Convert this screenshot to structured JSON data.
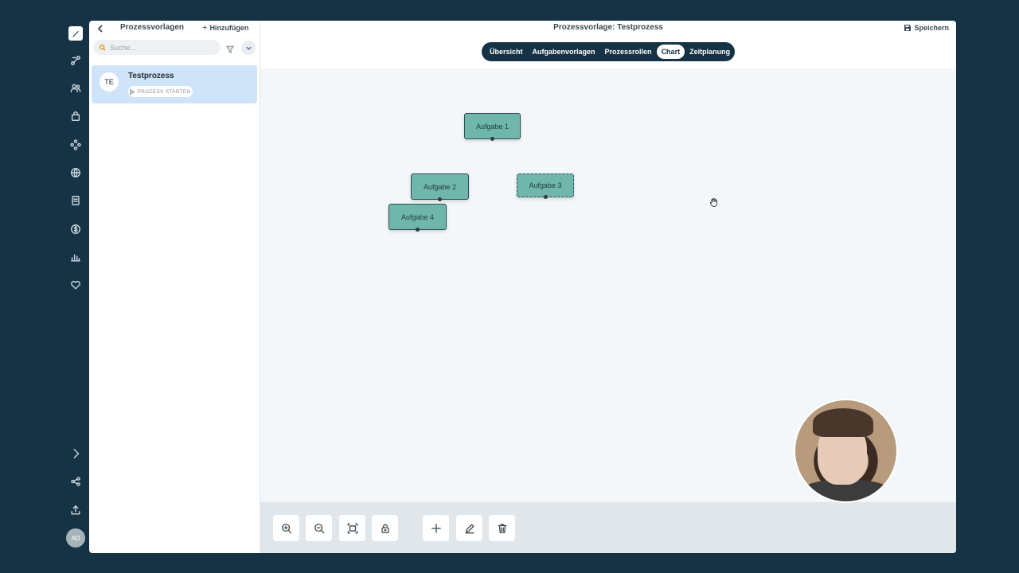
{
  "sidebar": {
    "icons": [
      "edit-icon",
      "process-icon",
      "users-icon",
      "bag-icon",
      "network-icon",
      "globe-icon",
      "book-icon",
      "dollar-icon",
      "bar-chart-icon",
      "heart-icon",
      "expand-icon",
      "share-icon",
      "upload-icon"
    ],
    "avatar_initials": "AD"
  },
  "list_panel": {
    "title": "Prozessvorlagen",
    "add_label": "Hinzufügen",
    "search_placeholder": "Suche...",
    "items": [
      {
        "initials": "TE",
        "name": "Testprozess",
        "action_label": "PROZESS STARTEN"
      }
    ]
  },
  "header": {
    "title": "Prozessvorlage: Testprozess",
    "save_label": "Speichern"
  },
  "tabs": [
    {
      "label": "Übersicht",
      "active": false
    },
    {
      "label": "Aufgabenvorlagen",
      "active": false
    },
    {
      "label": "Prozessrollen",
      "active": false
    },
    {
      "label": "Chart",
      "active": true
    },
    {
      "label": "Zeitplanung",
      "active": false
    }
  ],
  "canvas": {
    "nodes": [
      {
        "label": "Aufgabe 1"
      },
      {
        "label": "Aufgabe 2"
      },
      {
        "label": "Aufgabe 3",
        "selected": true
      },
      {
        "label": "Aufgabe 4"
      }
    ]
  },
  "toolbar": {
    "buttons": [
      "zoom-in-icon",
      "zoom-out-icon",
      "fit-view-icon",
      "lock-icon",
      "add-icon",
      "edit-icon",
      "delete-icon"
    ]
  },
  "colors": {
    "rail": "#163345",
    "node_fill": "#6fb7aa",
    "selected_item": "#cfe4f8",
    "accent": "#163345"
  }
}
